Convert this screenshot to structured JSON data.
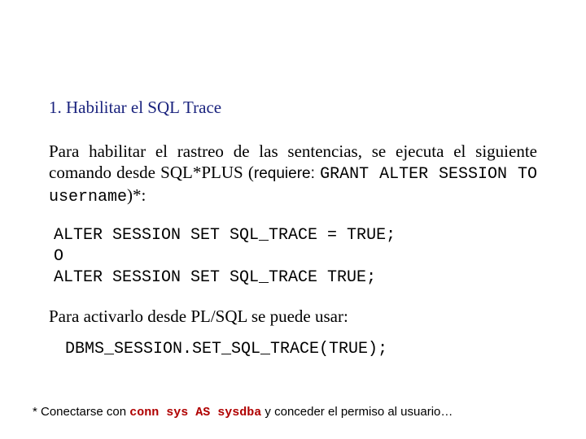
{
  "heading": "1. Habilitar el SQL Trace",
  "para1_a": "Para habilitar el rastreo de las sentencias, se ejecuta el siguiente comando desde SQL*PLUS (",
  "para1_req": "requiere: ",
  "para1_grant": "GRANT ALTER SESSION TO username",
  "para1_b": ")*:",
  "code1_line1": "ALTER SESSION SET SQL_TRACE = TRUE;",
  "code1_line2": "O",
  "code1_line3": "ALTER SESSION SET SQL_TRACE TRUE;",
  "para2": "Para activarlo desde PL/SQL se puede usar:",
  "code2": "DBMS_SESSION.SET_SQL_TRACE(TRUE);",
  "foot_a": "* Conectarse con ",
  "foot_cmd": "conn sys AS sysdba",
  "foot_b": " y conceder el permiso al usuario…"
}
